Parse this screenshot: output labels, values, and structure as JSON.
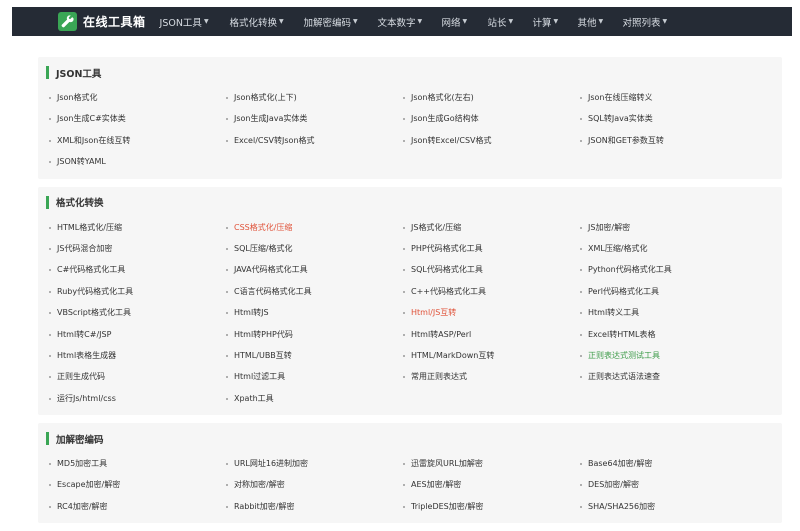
{
  "header": {
    "brand": "在线工具箱",
    "nav": [
      {
        "label": "JSON工具"
      },
      {
        "label": "格式化转换"
      },
      {
        "label": "加解密编码"
      },
      {
        "label": "文本数字"
      },
      {
        "label": "网络"
      },
      {
        "label": "站长"
      },
      {
        "label": "计算"
      },
      {
        "label": "其他"
      },
      {
        "label": "对照列表"
      }
    ]
  },
  "sections": [
    {
      "title": "JSON工具",
      "links": [
        {
          "label": "Json格式化"
        },
        {
          "label": "Json格式化(上下)"
        },
        {
          "label": "Json格式化(左右)"
        },
        {
          "label": "Json在线压缩转义"
        },
        {
          "label": "Json生成C#实体类"
        },
        {
          "label": "Json生成Java实体类"
        },
        {
          "label": "Json生成Go结构体"
        },
        {
          "label": "SQL转Java实体类"
        },
        {
          "label": "XML和Json在线互转"
        },
        {
          "label": "Excel/CSV转Json格式"
        },
        {
          "label": "Json转Excel/CSV格式"
        },
        {
          "label": "JSON和GET参数互转"
        },
        {
          "label": "JSON转YAML"
        }
      ]
    },
    {
      "title": "格式化转换",
      "links": [
        {
          "label": "HTML格式化/压缩"
        },
        {
          "label": "CSS格式化/压缩",
          "color": "red"
        },
        {
          "label": "JS格式化/压缩"
        },
        {
          "label": "JS加密/解密"
        },
        {
          "label": "JS代码混合加密"
        },
        {
          "label": "SQL压缩/格式化"
        },
        {
          "label": "PHP代码格式化工具"
        },
        {
          "label": "XML压缩/格式化"
        },
        {
          "label": "C#代码格式化工具"
        },
        {
          "label": "JAVA代码格式化工具"
        },
        {
          "label": "SQL代码格式化工具"
        },
        {
          "label": "Python代码格式化工具"
        },
        {
          "label": "Ruby代码格式化工具"
        },
        {
          "label": "C语言代码格式化工具"
        },
        {
          "label": "C++代码格式化工具"
        },
        {
          "label": "Perl代码格式化工具"
        },
        {
          "label": "VBScript格式化工具"
        },
        {
          "label": "Html转JS"
        },
        {
          "label": "Html/JS互转",
          "color": "red"
        },
        {
          "label": "Html转义工具"
        },
        {
          "label": "Html转C#/JSP"
        },
        {
          "label": "Html转PHP代码"
        },
        {
          "label": "Html转ASP/Perl"
        },
        {
          "label": "Excel转HTML表格"
        },
        {
          "label": "Html表格生成器"
        },
        {
          "label": "HTML/UBB互转"
        },
        {
          "label": "HTML/MarkDown互转"
        },
        {
          "label": "正则表达式测试工具",
          "color": "green"
        },
        {
          "label": "正则生成代码"
        },
        {
          "label": "Html过滤工具"
        },
        {
          "label": "常用正则表达式"
        },
        {
          "label": "正则表达式语法速查"
        },
        {
          "label": "运行Js/html/css"
        },
        {
          "label": "Xpath工具"
        }
      ]
    },
    {
      "title": "加解密编码",
      "links": [
        {
          "label": "MD5加密工具"
        },
        {
          "label": "URL网址16进制加密"
        },
        {
          "label": "迅雷旋风URL加解密"
        },
        {
          "label": "Base64加密/解密"
        },
        {
          "label": "Escape加密/解密"
        },
        {
          "label": "对称加密/解密"
        },
        {
          "label": "AES加密/解密"
        },
        {
          "label": "DES加密/解密"
        },
        {
          "label": "RC4加密/解密"
        },
        {
          "label": "Rabbit加密/解密"
        },
        {
          "label": "TripleDES加密/解密"
        },
        {
          "label": "SHA/SHA256加密"
        }
      ]
    }
  ],
  "colors": {
    "header_bg": "#252b35",
    "accent": "#3aa655",
    "highlight_red": "#e0533a",
    "highlight_green": "#3e9c4a"
  }
}
